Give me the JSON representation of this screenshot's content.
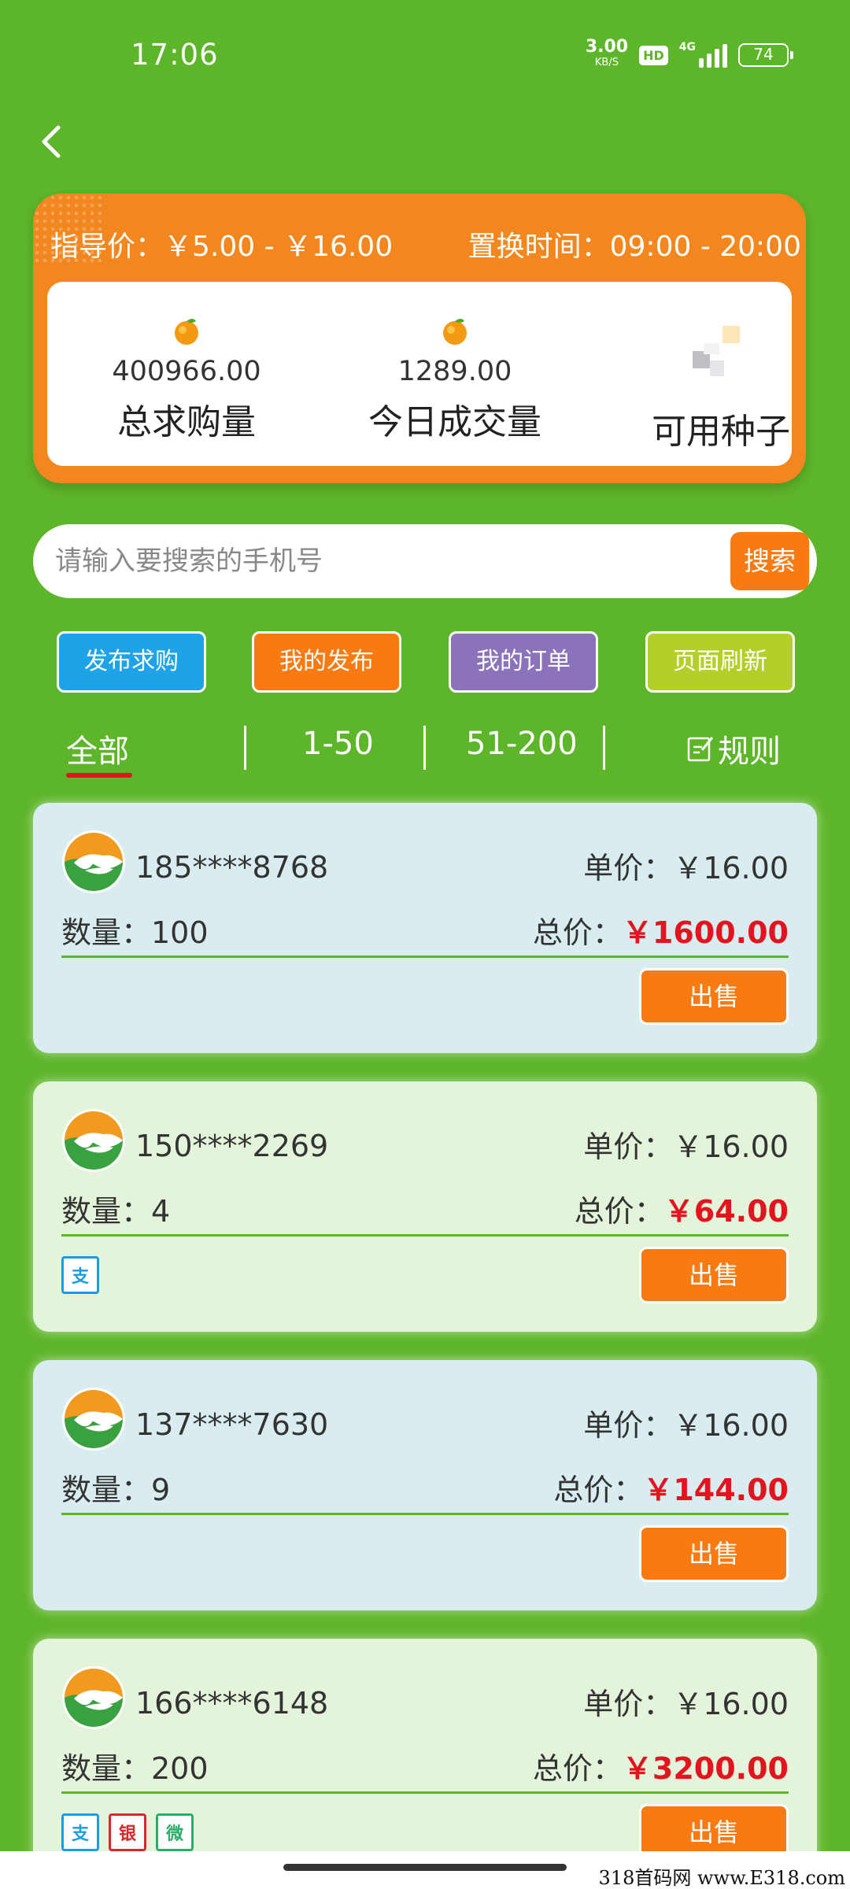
{
  "status_bar": {
    "time": "17:06",
    "speed_value": "3.00",
    "speed_unit": "KB/S",
    "hd": "HD",
    "network": "4G",
    "battery": "74"
  },
  "info_card": {
    "guide_price": "指导价：￥5.00 - ￥16.00",
    "swap_time": "置换时间：09:00 - 20:00",
    "stats": [
      {
        "value": "400966.00",
        "label": "总求购量"
      },
      {
        "value": "1289.00",
        "label": "今日成交量"
      },
      {
        "value": "",
        "label": "可用种子"
      }
    ]
  },
  "search": {
    "placeholder": "请输入要搜索的手机号",
    "button": "搜索"
  },
  "actions": {
    "publish": "发布求购",
    "mine": "我的发布",
    "orders": "我的订单",
    "refresh": "页面刷新"
  },
  "tabs": {
    "all": "全部",
    "range1": "1-50",
    "range2": "51-200",
    "rules": "规则"
  },
  "orders": [
    {
      "phone": "185****8768",
      "unit_price": "单价：￥16.00",
      "qty": "数量：100",
      "total_label": "总价：",
      "total": "￥1600.00",
      "sell": "出售",
      "payments": []
    },
    {
      "phone": "150****2269",
      "unit_price": "单价：￥16.00",
      "qty": "数量：4",
      "total_label": "总价：",
      "total": "￥64.00",
      "sell": "出售",
      "payments": [
        "alipay-icon"
      ]
    },
    {
      "phone": "137****7630",
      "unit_price": "单价：￥16.00",
      "qty": "数量：9",
      "total_label": "总价：",
      "total": "￥144.00",
      "sell": "出售",
      "payments": []
    },
    {
      "phone": "166****6148",
      "unit_price": "单价：￥16.00",
      "qty": "数量：200",
      "total_label": "总价：",
      "total": "￥3200.00",
      "sell": "出售",
      "payments": [
        "alipay-icon",
        "unionpay-icon",
        "wechat-pay-icon"
      ]
    }
  ],
  "watermark": "318首码网 www.E318.com",
  "colors": {
    "background": "#5db52a",
    "card_orange": "#f2871f",
    "accent_orange": "#f77a12",
    "price_red": "#e3141e",
    "blue_button": "#1fa3e8",
    "purple_button": "#8a73ba",
    "lime_button": "#b3cf2a"
  }
}
